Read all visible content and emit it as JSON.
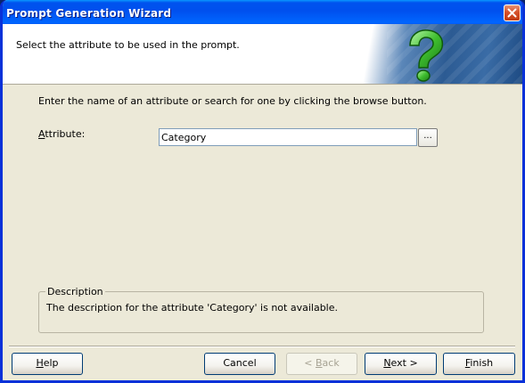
{
  "window": {
    "title": "Prompt Generation Wizard"
  },
  "header": {
    "instruction": "Select the attribute to be used in the prompt."
  },
  "main": {
    "instruction": "Enter the name of an attribute or search for one by clicking the browse button.",
    "attribute_label_accel": "A",
    "attribute_label_rest": "ttribute:",
    "attribute_value": "Category",
    "browse_label": "..."
  },
  "description": {
    "legend": "Description",
    "text": "The description for the attribute 'Category' is not available."
  },
  "buttons": {
    "help_accel": "H",
    "help_rest": "elp",
    "cancel": "Cancel",
    "back_prefix": "< ",
    "back_accel": "B",
    "back_rest": "ack",
    "next_accel": "N",
    "next_rest": "ext >",
    "finish_accel": "F",
    "finish_rest": "inish"
  },
  "colors": {
    "title_bar": "#0053ee",
    "dialog_bg": "#ece9d8",
    "close_button": "#d6512a"
  },
  "icons": {
    "close": "close-icon",
    "wizard": "question-mark-icon"
  }
}
